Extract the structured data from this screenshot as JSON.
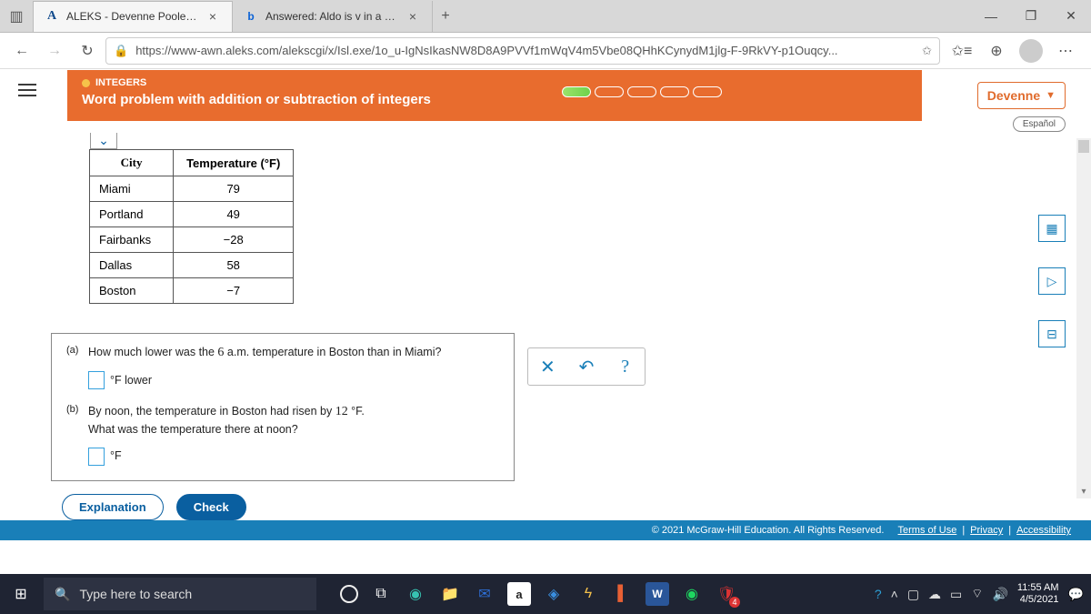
{
  "browser": {
    "tabs": [
      {
        "icon": "A",
        "title": "ALEKS - Devenne Poole - Learn"
      },
      {
        "icon": "b",
        "title": "Answered: Aldo is v in a bike rac"
      }
    ],
    "url": "https://www-awn.aleks.com/alekscgi/x/Isl.exe/1o_u-IgNsIkasNW8D8A9PVVf1mWqV4m5Vbe08QHhKCynydM1jlg-F-9RkVY-p1Ouqcy..."
  },
  "header": {
    "topic": "INTEGERS",
    "lesson": "Word problem with addition or subtraction of integers",
    "user": "Devenne",
    "lang": "Español"
  },
  "table": {
    "headers": {
      "city": "City",
      "temp": "Temperature (°F)"
    },
    "rows": [
      {
        "city": "Miami",
        "temp": "79"
      },
      {
        "city": "Portland",
        "temp": "49"
      },
      {
        "city": "Fairbanks",
        "temp": "−28"
      },
      {
        "city": "Dallas",
        "temp": "58"
      },
      {
        "city": "Boston",
        "temp": "−7"
      }
    ]
  },
  "questions": {
    "a": {
      "label": "(a)",
      "text_before": "How much lower was the ",
      "num": "6",
      "text_after": " a.m. temperature in Boston than in Miami?",
      "ans_label": "°F lower"
    },
    "b": {
      "label": "(b)",
      "line1_before": "By noon, the temperature in Boston had risen by ",
      "line1_num": "12",
      "line1_after": " °F.",
      "line2": "What was the temperature there at noon?",
      "ans_label": "°F"
    }
  },
  "buttons": {
    "explanation": "Explanation",
    "check": "Check"
  },
  "footer": {
    "copyright": "© 2021 McGraw-Hill Education. All Rights Reserved.",
    "terms": "Terms of Use",
    "privacy": "Privacy",
    "access": "Accessibility"
  },
  "taskbar": {
    "search_placeholder": "Type here to search",
    "time": "11:55 AM",
    "date": "4/5/2021"
  }
}
